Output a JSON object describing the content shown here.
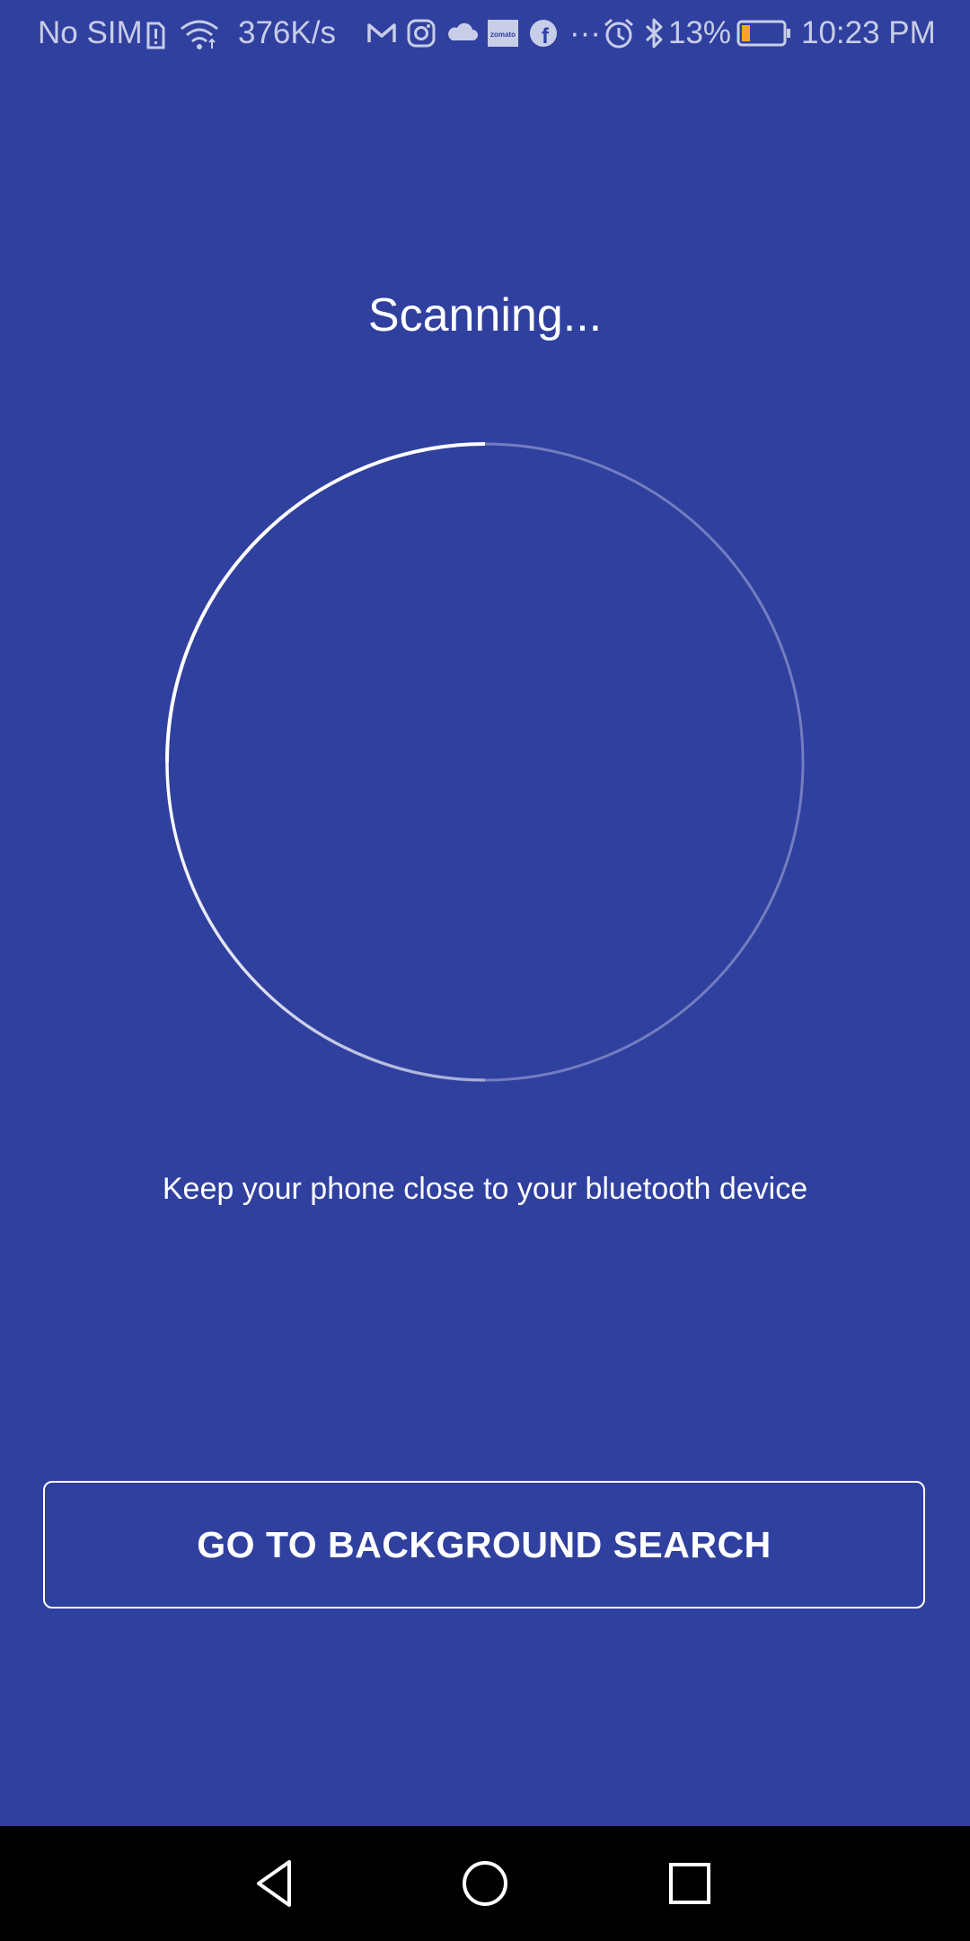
{
  "status_bar": {
    "carrier": "No SIM",
    "network_speed": "376K/s",
    "battery_percent": "13%",
    "battery_level": 0.13,
    "time": "10:23 PM",
    "overflow": "···",
    "notification_icons": [
      "gmail-icon",
      "instagram-icon",
      "cloud-icon",
      "zomato-icon",
      "facebook-icon"
    ],
    "system_icons": [
      "sim-alert-icon",
      "wifi-icon",
      "alarm-icon",
      "bluetooth-icon",
      "battery-icon"
    ],
    "zomato_label": "zomato",
    "facebook_label": "f",
    "text_color": "#c8cde8"
  },
  "main": {
    "title": "Scanning...",
    "hint": "Keep your phone close to your bluetooth device",
    "button_label": "GO TO BACKGROUND SEARCH",
    "background_color": "#30409f"
  },
  "nav_bar": {
    "back": "back-icon",
    "home": "home-icon",
    "recents": "recents-icon"
  }
}
